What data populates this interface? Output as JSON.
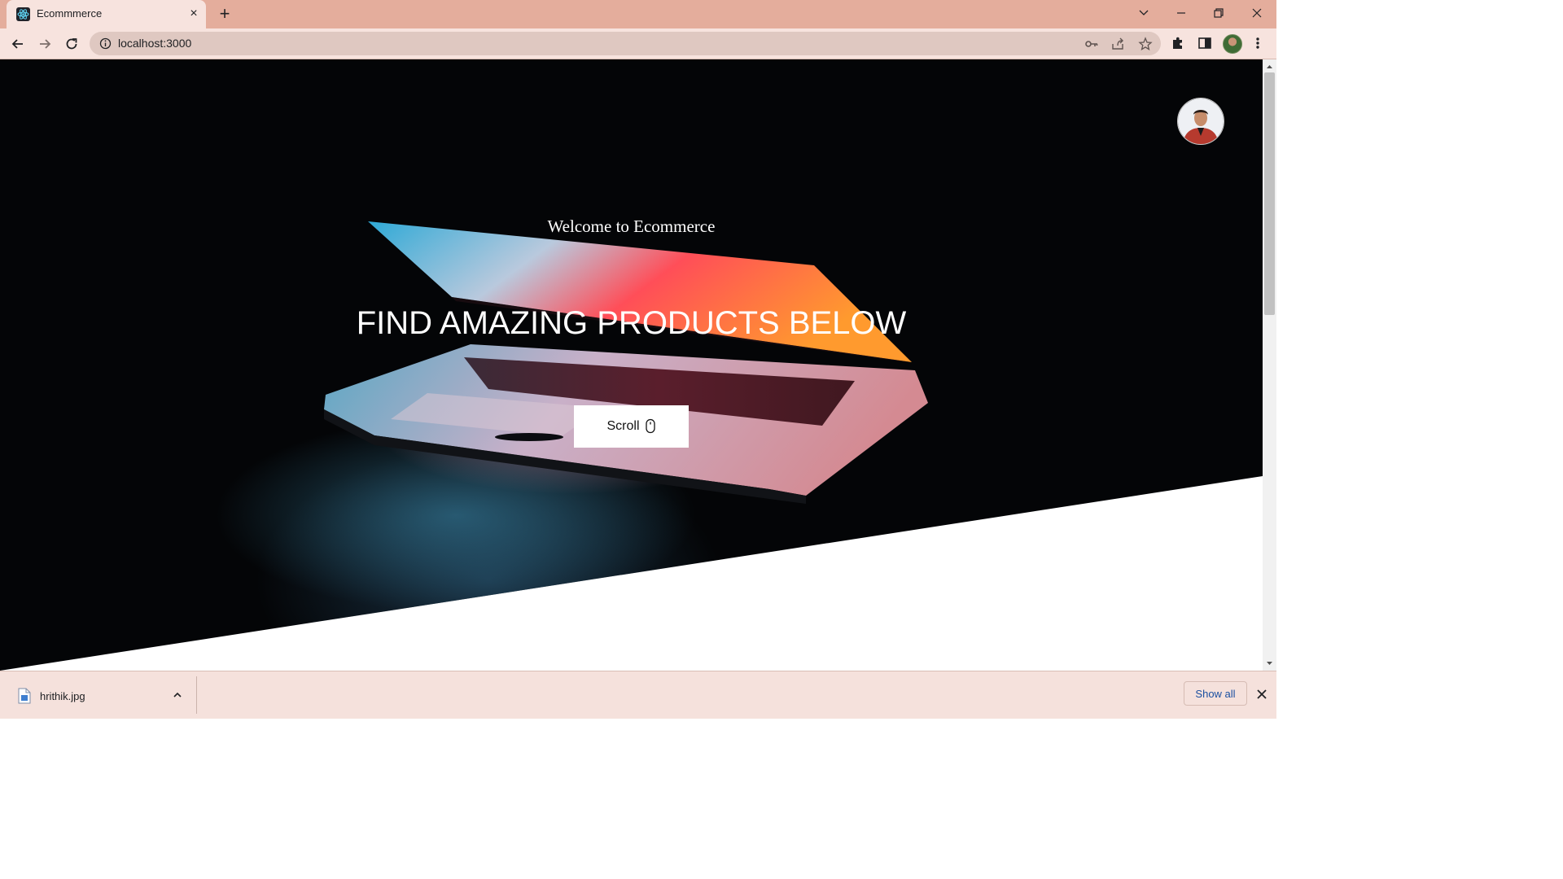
{
  "browser": {
    "tab": {
      "title": "Ecommmerce",
      "favicon": "react-logo-icon",
      "close": "×"
    },
    "new_tab": "+",
    "window_controls": [
      "tab-search-icon",
      "minimize-icon",
      "restore-icon",
      "close-icon"
    ],
    "toolbar": {
      "back": "back-arrow-icon",
      "forward": "forward-arrow-icon",
      "reload": "reload-icon",
      "url": "localhost:3000",
      "omnibox_icons": [
        "key-icon",
        "share-icon",
        "star-icon"
      ],
      "extensions": "puzzle-icon",
      "side_panel": "side-panel-icon",
      "menu": "kebab-menu-icon"
    }
  },
  "page": {
    "welcome": "Welcome to Ecommerce",
    "headline": "FIND AMAZING PRODUCTS BELOW",
    "scroll_button": "Scroll",
    "scroll_icon": "mouse-icon",
    "user_avatar": "user-avatar"
  },
  "downloads": {
    "file_name": "hrithik.jpg",
    "file_icon": "image-file-icon",
    "show_all": "Show all"
  },
  "colors": {
    "tabstrip": "#e4ad9c",
    "toolbar": "#f7e3de",
    "hero_background": "#040507",
    "link_blue": "#1a4fa0"
  }
}
